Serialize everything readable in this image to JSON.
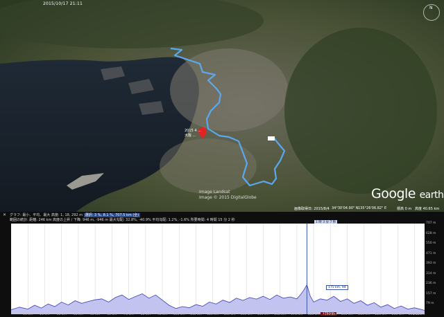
{
  "app": {
    "name": "Google Earth",
    "brand_google": "Google",
    "brand_earth": "earth"
  },
  "timebar": {
    "date_label": "2015/10/17 21:11"
  },
  "map": {
    "credit_line1": "Image Landsat",
    "credit_line2": "Image © 2015 DigitalGlobe",
    "pin_label_1": "2015 4 ...",
    "pin_label_2": "大阪 ...",
    "track_color": "#5aa9f0",
    "pin_color": "#e02424"
  },
  "status": {
    "imagery_date": "画像取得日: 2015/8/4",
    "latitude": "34°30'04.90\" N",
    "longitude": "135°26'06.82\" E",
    "elevation": "標高  0 m",
    "eye_alt": "高度  40.65 km"
  },
  "profile": {
    "toolbar_line1": "グラフ: 最小、平均、最大 高度: 1, 18, 292 m",
    "toolbar_highlight": "選択: 3 %, 8.1 %, 707.5 km (全)",
    "toolbar_line2": "範囲の統計: 距離: 246 km  高度の上昇 / 下降: 946 m, -946 m  最大勾配: 32.8%, -40.9%  平均勾配: 1.2%, -1.6%  所要時間: 4 時間 15 分 2 秒",
    "cursor_top_label": "1 時 3 分 7 秒",
    "cursor_tip_label": "175 km, 94",
    "cursor_x_label": "176 km",
    "fill_color": "#c3c3f0",
    "line_color": "#3b3bb3",
    "cursor_color": "#3455a8"
  },
  "chart_data": {
    "type": "area",
    "xlabel": "",
    "ylabel": "",
    "xlim": [
      0,
      246
    ],
    "ylim": [
      0,
      707
    ],
    "x_ticks": [
      "10 km",
      "20 km",
      "30 km",
      "40 km",
      "50 km",
      "60 km",
      "70 km",
      "80 km",
      "90 km",
      "100 km",
      "110 km",
      "120 km",
      "130 km",
      "140 km",
      "150 km",
      "160 km",
      "170 km",
      "180 km",
      "190 km",
      "200 km",
      "210 km",
      "220 km",
      "230 km",
      "240 km"
    ],
    "x_tick_values": [
      10,
      20,
      30,
      40,
      50,
      60,
      70,
      80,
      90,
      100,
      110,
      120,
      130,
      140,
      150,
      160,
      170,
      180,
      190,
      200,
      210,
      220,
      230,
      240
    ],
    "x_end_label": "246 km",
    "y_ticks": [
      "707 m",
      "628 m",
      "550 m",
      "471 m",
      "393 m",
      "314 m",
      "236 m",
      "157 m",
      "79 m"
    ],
    "y_tick_values": [
      707,
      628,
      550,
      471,
      393,
      314,
      236,
      157,
      79
    ],
    "grid": true,
    "cursor_x": 176,
    "x": [
      0,
      5,
      10,
      14,
      18,
      22,
      26,
      30,
      34,
      38,
      42,
      46,
      50,
      54,
      58,
      62,
      66,
      70,
      74,
      78,
      82,
      86,
      90,
      94,
      98,
      102,
      106,
      110,
      114,
      118,
      122,
      126,
      130,
      134,
      138,
      142,
      146,
      150,
      154,
      158,
      162,
      166,
      170,
      172,
      174,
      176,
      178,
      180,
      184,
      188,
      192,
      196,
      200,
      204,
      208,
      212,
      216,
      220,
      224,
      228,
      232,
      236,
      240,
      246
    ],
    "y": [
      35,
      55,
      40,
      70,
      48,
      80,
      60,
      95,
      72,
      105,
      85,
      100,
      112,
      120,
      95,
      130,
      150,
      115,
      138,
      160,
      125,
      150,
      110,
      70,
      45,
      60,
      50,
      75,
      62,
      95,
      80,
      110,
      92,
      125,
      108,
      130,
      118,
      140,
      115,
      150,
      125,
      135,
      120,
      150,
      185,
      230,
      140,
      95,
      120,
      110,
      140,
      100,
      120,
      85,
      105,
      70,
      90,
      55,
      75,
      45,
      65,
      40,
      50,
      30
    ]
  }
}
